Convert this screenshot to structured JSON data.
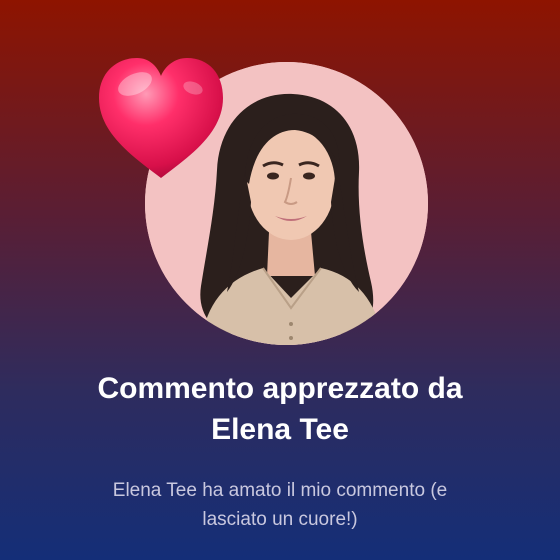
{
  "notification": {
    "title_line1": "Commento apprezzato da",
    "title_line2": "Elena Tee",
    "message_line1": "Elena Tee ha amato il mio commento (e",
    "message_line2": "lasciato un cuore!)"
  },
  "icons": {
    "reaction": "heart-icon"
  },
  "colors": {
    "background_top": "#8e1400",
    "background_bottom": "#142e78",
    "avatar_background": "#f3c2c2",
    "heart": "#e8174f",
    "title_text": "#ffffff",
    "message_text": "#c9c8df"
  }
}
